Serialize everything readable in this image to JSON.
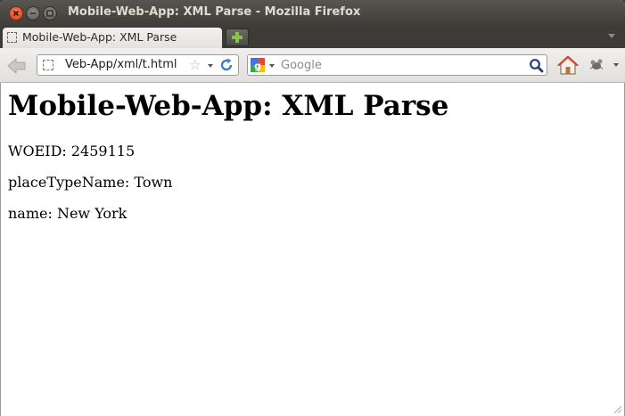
{
  "window": {
    "title": "Mobile-Web-App: XML Parse - Mozilla Firefox"
  },
  "tabs": [
    {
      "label": "Mobile-Web-App: XML Parse",
      "active": true
    }
  ],
  "navbar": {
    "url": "Veb-App/xml/t.html",
    "search_placeholder": "Google",
    "search_value": ""
  },
  "page": {
    "heading": "Mobile-Web-App: XML Parse",
    "lines": [
      "WOEID: 2459115",
      "placeTypeName: Town",
      "name: New York"
    ]
  },
  "icons": {
    "close": "close-icon",
    "minimize": "minimize-icon",
    "maximize": "maximize-icon",
    "new_tab": "plus-icon",
    "back": "back-arrow-icon",
    "bookmark": "star-icon",
    "reload": "reload-icon",
    "search_engine": "google-icon",
    "search": "magnifier-icon",
    "home": "home-icon",
    "addon": "addon-icon"
  },
  "colors": {
    "titlebar": "#3c3b37",
    "close_button": "#e8582e",
    "new_tab_plus": "#8bc34a",
    "home_roof": "#d9452b"
  }
}
